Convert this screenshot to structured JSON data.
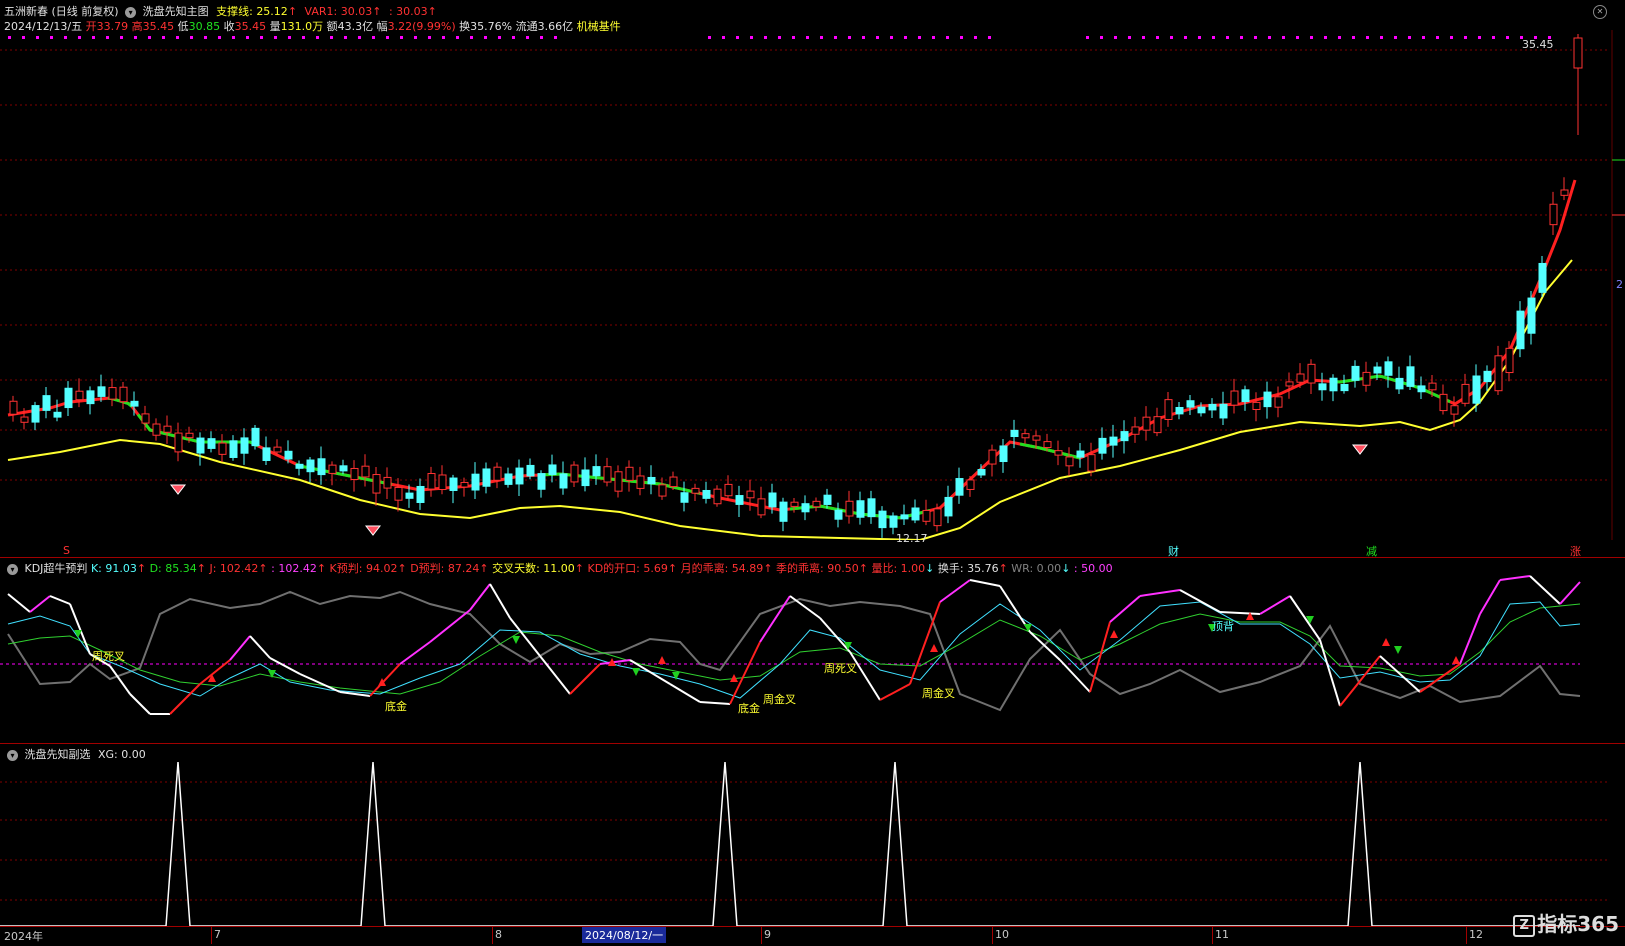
{
  "header": {
    "stock_name": "五洲新春",
    "period": "(日线 前复权)",
    "indicator": "洗盘先知主图",
    "support_label": "支撑线:",
    "support_value": "25.12",
    "var1_label": "VAR1:",
    "var1_value": "30.03",
    "extra_value": ": 30.03",
    "date": "2024/12/13/五",
    "open_label": "开",
    "open": "33.79",
    "high_label": "高",
    "high": "35.45",
    "low_label": "低",
    "low": "30.85",
    "close_label": "收",
    "close": "35.45",
    "vol_label": "量",
    "vol": "131.0万",
    "amt_label": "额",
    "amt": "43.3亿",
    "chg_label": "幅",
    "chg": "3.22(9.99%)",
    "turn_label": "换",
    "turn": "35.76%",
    "float_label": "流通",
    "float": "3.66亿",
    "sector": "机械基件"
  },
  "price_marks": {
    "high_label": "35.45",
    "low_label": "12.17"
  },
  "event_badges": {
    "s": "S",
    "cai": "财",
    "jian": "减",
    "zhang": "涨",
    "edge": "2"
  },
  "kdj": {
    "title": "KDJ超牛预判",
    "k": "K: 91.03",
    "d": "D: 85.34",
    "j": "J: 102.42",
    "j2": ": 102.42",
    "kpred": "K预判: 94.02",
    "dpred": "D预判: 87.24",
    "cross_days": "交叉天数: 11.00",
    "kd_open": "KD的开口: 5.69",
    "month_dev": "月的乖离: 54.89",
    "season_dev": "季的乖离: 90.50",
    "vol_ratio": "量比: 1.00",
    "turnover": "换手: 35.76",
    "wr": "WR: 0.00",
    "val50": ": 50.00",
    "labels": {
      "week_dead": "周死叉",
      "bottom_gold1": "底金",
      "bottom_gold2": "底金",
      "week_gold1": "周金叉",
      "week_dead2": "周死叉",
      "week_gold2": "周金叉",
      "top_div": "顶背"
    }
  },
  "xg": {
    "title": "洗盘先知副选",
    "xg": "XG: 0.00"
  },
  "xaxis": {
    "year": "2024年",
    "m7": "7",
    "m8": "8",
    "cursor_date": "2024/08/12/一",
    "m9": "9",
    "m10": "10",
    "m11": "11",
    "m12": "12"
  },
  "watermark": "指标365",
  "colors": {
    "up": "#ff3232",
    "down": "#54ffff",
    "ma_red": "#ff2020",
    "ma_green": "#20e020",
    "support": "#ffff30",
    "grid": "#800000",
    "magenta": "#ff00ff"
  },
  "chart_data": [
    {
      "type": "candlestick",
      "title": "洗盘先知主图",
      "series": [
        {
          "name": "支撑线",
          "values": [
            25.12
          ]
        },
        {
          "name": "VAR1",
          "values": [
            30.03
          ]
        }
      ],
      "annotations": [
        "35.45",
        "12.17"
      ]
    },
    {
      "type": "line",
      "title": "KDJ超牛预判",
      "series": [
        {
          "name": "K",
          "values": [
            91.03
          ]
        },
        {
          "name": "D",
          "values": [
            85.34
          ]
        },
        {
          "name": "J",
          "values": [
            102.42
          ]
        }
      ]
    },
    {
      "type": "line",
      "title": "洗盘先知副选",
      "series": [
        {
          "name": "XG",
          "values": [
            0,
            0,
            1,
            0,
            1,
            0,
            1,
            0,
            1,
            0,
            1,
            0
          ]
        }
      ]
    }
  ]
}
